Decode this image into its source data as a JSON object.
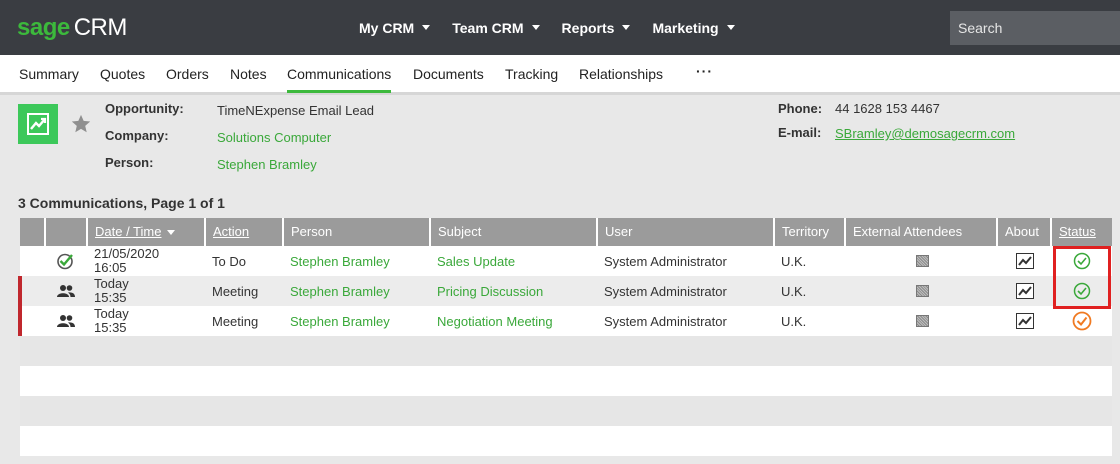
{
  "app": {
    "logo_sage": "sage",
    "logo_crm": "CRM"
  },
  "topnav": [
    "My CRM",
    "Team CRM",
    "Reports",
    "Marketing"
  ],
  "search": {
    "placeholder": "Search"
  },
  "tabs": [
    "Summary",
    "Quotes",
    "Orders",
    "Notes",
    "Communications",
    "Documents",
    "Tracking",
    "Relationships"
  ],
  "active_tab": "Communications",
  "more_label": "···",
  "info": {
    "opportunity_label": "Opportunity:",
    "opportunity": "TimeNExpense Email Lead",
    "company_label": "Company:",
    "company": "Solutions Computer",
    "person_label": "Person:",
    "person": "Stephen Bramley",
    "phone_label": "Phone:",
    "phone": "44 1628 153 4467",
    "email_label": "E-mail:",
    "email": "SBramley@demosagecrm.com"
  },
  "list_title": "3 Communications, Page 1 of 1",
  "columns": [
    "Date / Time",
    "Action",
    "Person",
    "Subject",
    "User",
    "Territory",
    "External Attendees",
    "About",
    "Status"
  ],
  "rows": [
    {
      "type_icon": "checked-task-icon",
      "date": "21/05/2020",
      "time": "16:05",
      "action": "To Do",
      "person": "Stephen Bramley",
      "subject": "Sales Update",
      "user": "System Administrator",
      "territory": "U.K.",
      "status": "complete",
      "marker": false
    },
    {
      "type_icon": "people-icon",
      "date": "Today",
      "time": "15:35",
      "action": "Meeting",
      "person": "Stephen Bramley",
      "subject": "Pricing Discussion",
      "user": "System Administrator",
      "territory": "U.K.",
      "status": "complete",
      "marker": true
    },
    {
      "type_icon": "people-icon",
      "date": "Today",
      "time": "15:35",
      "action": "Meeting",
      "person": "Stephen Bramley",
      "subject": "Negotiation Meeting",
      "user": "System Administrator",
      "territory": "U.K.",
      "status": "pending",
      "marker": true
    }
  ],
  "colors": {
    "brand_green": "#3cb93c",
    "link_green": "#3aa83a",
    "header_grey": "#9b9b9b",
    "status_complete": "#3aa83a",
    "status_pending": "#f07a22",
    "highlight_red": "#e02020"
  }
}
